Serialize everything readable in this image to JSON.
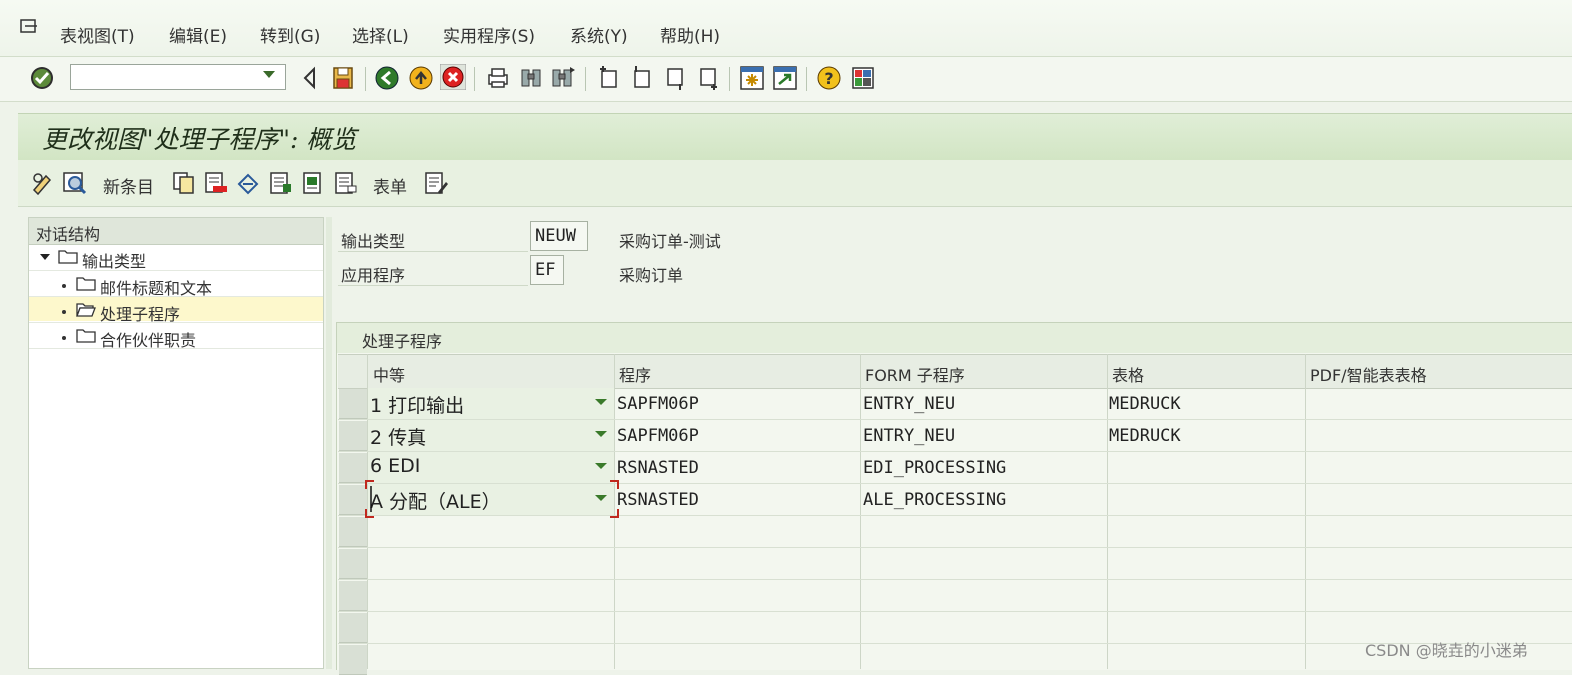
{
  "menu": {
    "items": [
      "表视图(T)",
      "编辑(E)",
      "转到(G)",
      "选择(L)",
      "实用程序(S)",
      "系统(Y)",
      "帮助(H)"
    ]
  },
  "toolbar": {
    "command_value": "",
    "icons": [
      "enter-check-icon",
      "back-triangle-icon",
      "save-icon",
      "back-icon",
      "exit-icon",
      "cancel-icon",
      "print-icon",
      "find-icon",
      "find-next-icon",
      "first-page-icon",
      "previous-page-icon",
      "next-page-icon",
      "last-page-icon",
      "new-session-icon",
      "shortcut-icon",
      "help-icon",
      "layout-icon"
    ]
  },
  "title": "更改视图\"处理子程序\": 概览",
  "app_toolbar": {
    "new_entries": "新条目",
    "form": "表单"
  },
  "tree": {
    "header": "对话结构",
    "root": "输出类型",
    "children": [
      "邮件标题和文本",
      "处理子程序",
      "合作伙伴职责"
    ],
    "selected": "处理子程序"
  },
  "header_fields": [
    {
      "label": "输出类型",
      "value": "NEUW",
      "description": "采购订单-测试"
    },
    {
      "label": "应用程序",
      "value": "EF",
      "description": "采购订单"
    }
  ],
  "table": {
    "caption": "处理子程序",
    "columns": [
      "中等",
      "程序",
      "FORM 子程序",
      "表格",
      "PDF/智能表表格"
    ],
    "rows": [
      {
        "medium": "1 打印输出",
        "program": "SAPFM06P",
        "form_routine": "ENTRY_NEU",
        "form": "MEDRUCK",
        "pdf_form": ""
      },
      {
        "medium": "2 传真",
        "program": "SAPFM06P",
        "form_routine": "ENTRY_NEU",
        "form": "MEDRUCK",
        "pdf_form": ""
      },
      {
        "medium": "6 EDI",
        "program": "RSNASTED",
        "form_routine": "EDI_PROCESSING",
        "form": "",
        "pdf_form": ""
      },
      {
        "medium": "A 分配（ALE）",
        "program": "RSNASTED",
        "form_routine": "ALE_PROCESSING",
        "form": "",
        "pdf_form": ""
      }
    ]
  },
  "watermark": "CSDN @晓垚的小迷弟"
}
